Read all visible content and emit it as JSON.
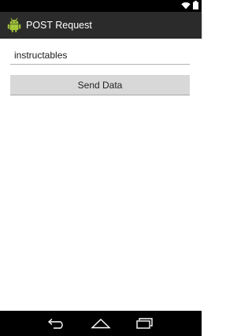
{
  "status_bar": {
    "icons": [
      "wifi-icon",
      "battery-icon"
    ]
  },
  "action_bar": {
    "icon": "android-app-icon",
    "title": "POST Request"
  },
  "form": {
    "input_value": "instructables",
    "send_button_label": "Send Data"
  },
  "nav_bar": {
    "buttons": [
      "back-icon",
      "home-icon",
      "recent-apps-icon"
    ]
  },
  "colors": {
    "action_bar_bg": "#2b2b2b",
    "button_bg": "#d8d8d8",
    "android_green": "#a4c639"
  }
}
